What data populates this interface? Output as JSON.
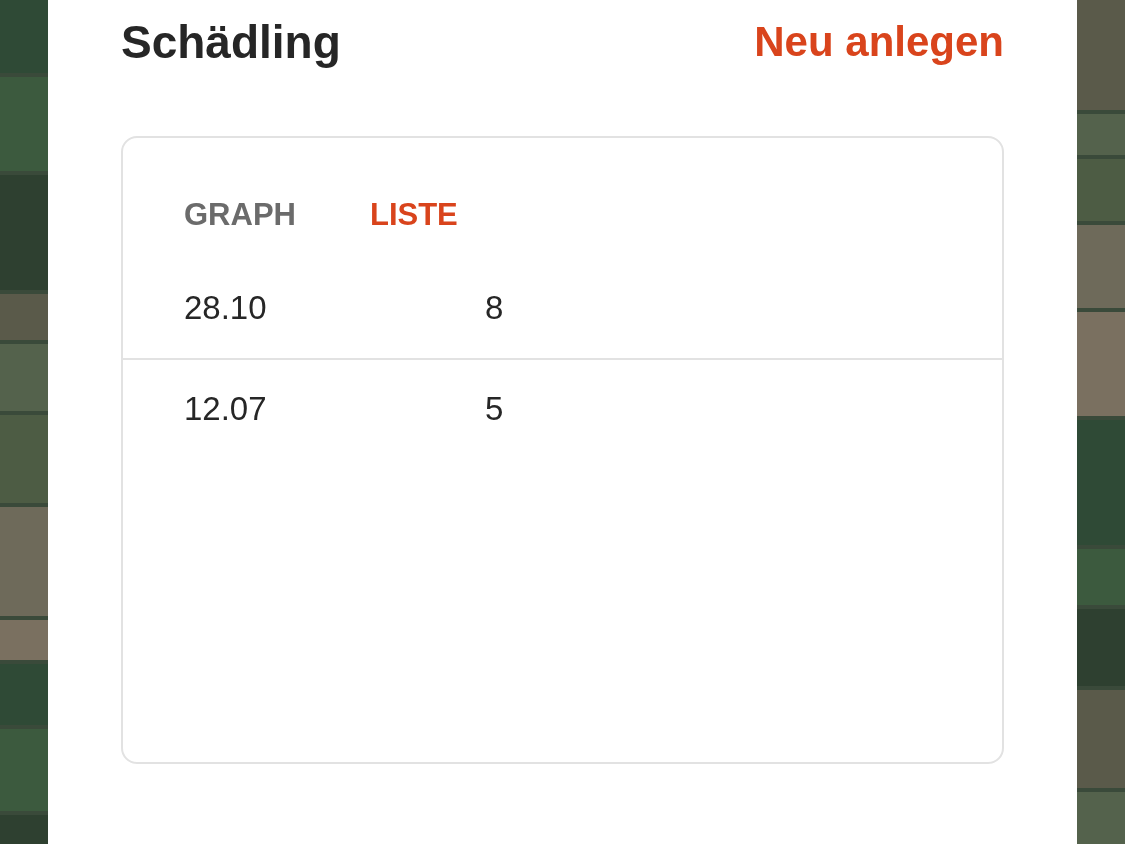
{
  "header": {
    "title": "Schädling",
    "action": "Neu anlegen"
  },
  "tabs": [
    {
      "label": "GRAPH",
      "selected": false
    },
    {
      "label": "LISTE",
      "selected": true
    }
  ],
  "rows": [
    {
      "date": "28.10",
      "value": "8"
    },
    {
      "date": "12.07",
      "value": "5"
    }
  ]
}
